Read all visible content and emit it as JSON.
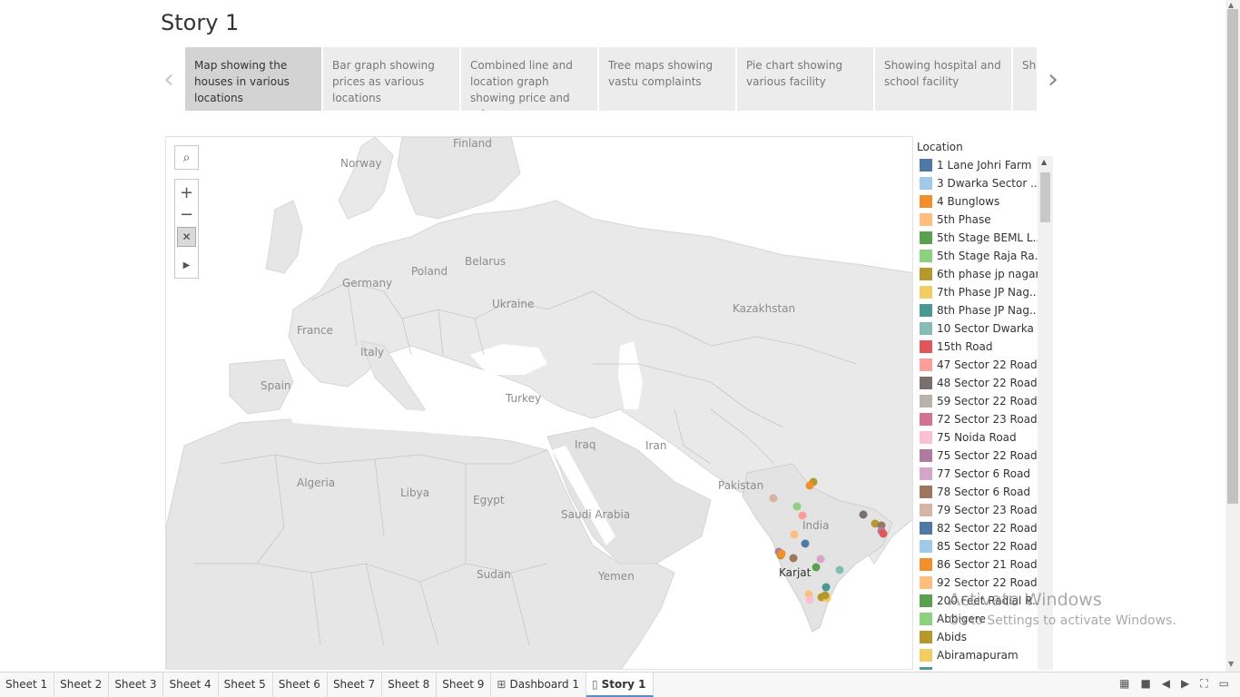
{
  "story": {
    "title": "Story 1",
    "prev_arrow": "‹",
    "next_arrow": "›",
    "points": [
      "Map showing the houses in various locations",
      "Bar graph showing prices as various locations",
      "Combined line and location graph showing price and rain",
      "Tree maps showing vastu complaints",
      "Pie chart showing various facility",
      "Showing hospital and school facility",
      "Sho... and..."
    ]
  },
  "map": {
    "labels": {
      "finland": "Finland",
      "norway": "Norway",
      "belarus": "Belarus",
      "poland": "Poland",
      "germany": "Germany",
      "ukraine": "Ukraine",
      "kazakhstan": "Kazakhstan",
      "france": "France",
      "italy": "Italy",
      "spain": "Spain",
      "turkey": "Turkey",
      "iraq": "Iraq",
      "iran": "Iran",
      "pakistan": "Pakistan",
      "algeria": "Algeria",
      "libya": "Libya",
      "egypt": "Egypt",
      "saudi_arabia": "Saudi Arabia",
      "india": "India",
      "sudan": "Sudan",
      "yemen": "Yemen",
      "karjat": "Karjat"
    },
    "tools": {
      "search": "⌕",
      "zoom_in": "+",
      "zoom_out": "−",
      "pin": "✕",
      "play": "▶"
    }
  },
  "legend": {
    "title": "Location",
    "items": [
      {
        "label": "1 Lane Johri Farm",
        "color": "#4e79a7"
      },
      {
        "label": "3 Dwarka Sector ..",
        "color": "#a0cbe8"
      },
      {
        "label": "4 Bunglows",
        "color": "#f28e2b"
      },
      {
        "label": "5th Phase",
        "color": "#ffbe7d"
      },
      {
        "label": "5th Stage BEML L..",
        "color": "#59a14f"
      },
      {
        "label": "5th Stage Raja Ra..",
        "color": "#8cd17d"
      },
      {
        "label": "6th phase jp nagar",
        "color": "#b6992d"
      },
      {
        "label": "7th Phase JP Nag..",
        "color": "#f1ce63"
      },
      {
        "label": "8th Phase JP Nag..",
        "color": "#499894"
      },
      {
        "label": "10 Sector Dwarka",
        "color": "#86bcb6"
      },
      {
        "label": "15th Road",
        "color": "#e15759"
      },
      {
        "label": "47 Sector 22 Road",
        "color": "#ff9d9a"
      },
      {
        "label": "48 Sector 22 Road",
        "color": "#79706e"
      },
      {
        "label": "59 Sector 22 Road",
        "color": "#bab0ac"
      },
      {
        "label": "72 Sector 23 Road",
        "color": "#d37295"
      },
      {
        "label": "75 Noida Road",
        "color": "#fabfd2"
      },
      {
        "label": "75 Sector 22 Road",
        "color": "#b07aa1"
      },
      {
        "label": "77 Sector 6 Road",
        "color": "#d4a6c8"
      },
      {
        "label": "78 Sector 6 Road",
        "color": "#9d7660"
      },
      {
        "label": "79 Sector 23 Road",
        "color": "#d7b5a6"
      },
      {
        "label": "82 Sector 22 Road",
        "color": "#4e79a7"
      },
      {
        "label": "85 Sector 22 Road",
        "color": "#a0cbe8"
      },
      {
        "label": "86 Sector 21 Road",
        "color": "#f28e2b"
      },
      {
        "label": "92 Sector 22 Road",
        "color": "#ffbe7d"
      },
      {
        "label": "200 Feet Radial R..",
        "color": "#59a14f"
      },
      {
        "label": "Abbigere",
        "color": "#8cd17d"
      },
      {
        "label": "Abids",
        "color": "#b6992d"
      },
      {
        "label": "Abiramapuram",
        "color": "#f1ce63"
      },
      {
        "label": "",
        "color": "#499894"
      }
    ]
  },
  "watermark": {
    "title": "Activate Windows",
    "subtitle": "Go to Settings to activate Windows."
  },
  "tabs": [
    {
      "label": "Sheet 1",
      "icon": "",
      "active": false
    },
    {
      "label": "Sheet 2",
      "icon": "",
      "active": false
    },
    {
      "label": "Sheet 3",
      "icon": "",
      "active": false
    },
    {
      "label": "Sheet 4",
      "icon": "",
      "active": false
    },
    {
      "label": "Sheet 5",
      "icon": "",
      "active": false
    },
    {
      "label": "Sheet 6",
      "icon": "",
      "active": false
    },
    {
      "label": "Sheet 7",
      "icon": "",
      "active": false
    },
    {
      "label": "Sheet 8",
      "icon": "",
      "active": false
    },
    {
      "label": "Sheet 9",
      "icon": "",
      "active": false
    },
    {
      "label": "Dashboard 1",
      "icon": "⊞",
      "active": false
    },
    {
      "label": "Story 1",
      "icon": "▯",
      "active": true
    }
  ],
  "status_icons": [
    "grid-view-icon",
    "slide-view-icon",
    "prev-icon",
    "next-icon",
    "fit-icon",
    "presentation-icon"
  ]
}
